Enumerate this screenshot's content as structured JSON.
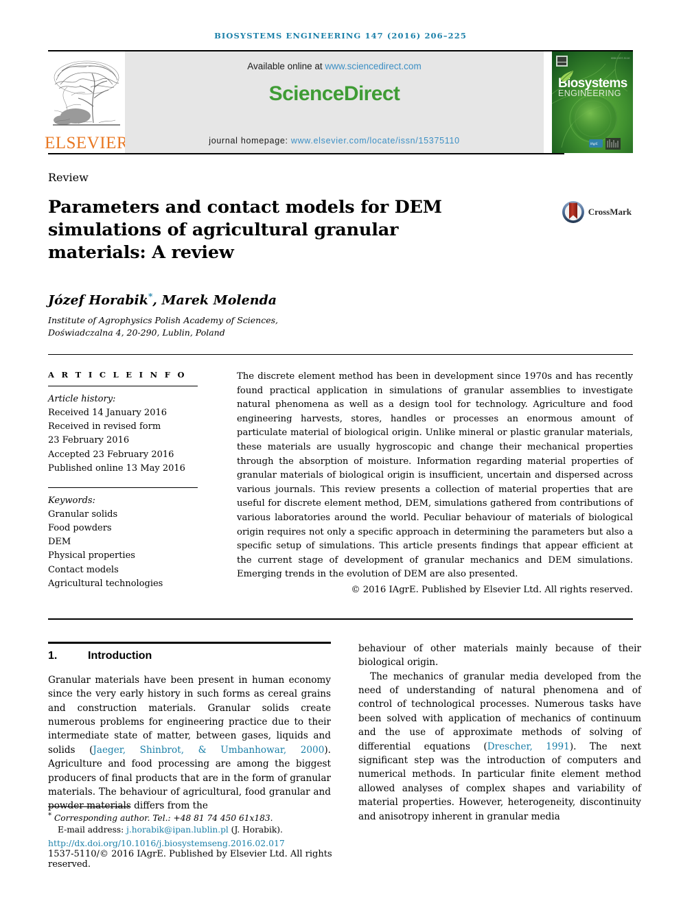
{
  "running_head": "BIOSYSTEMS ENGINEERING 147 (2016) 206–225",
  "masthead": {
    "publisher_name": "ELSEVIER",
    "available_prefix": "Available online at ",
    "available_url": "www.sciencedirect.com",
    "sciencedirect_logo": "ScienceDirect",
    "homepage_label": "journal homepage: ",
    "homepage_url": "www.elsevier.com/locate/issn/15375110",
    "cover_title_line1": "Biosystems",
    "cover_title_line2": "ENGINEERING"
  },
  "article": {
    "kicker": "Review",
    "title": "Parameters and contact models for DEM simulations of agricultural granular materials: A review",
    "crossmark_label": "CrossMark",
    "authors": "Józef Horabik",
    "authors_marker": "*",
    "authors_rest": ", Marek Molenda",
    "affiliation_line1": "Institute of Agrophysics Polish Academy of Sciences,",
    "affiliation_line2": "Doświadczalna 4, 20-290, Lublin, Poland"
  },
  "article_info": {
    "heading": "A R T I C L E   I N F O",
    "history_label": "Article history:",
    "history": [
      "Received 14 January 2016",
      "Received in revised form",
      "23 February 2016",
      "Accepted 23 February 2016",
      "Published online 13 May 2016"
    ],
    "keywords_label": "Keywords:",
    "keywords": [
      "Granular solids",
      "Food powders",
      "DEM",
      "Physical properties",
      "Contact models",
      "Agricultural technologies"
    ]
  },
  "abstract": {
    "text": "The discrete element method has been in development since 1970s and has recently found practical application in simulations of granular assemblies to investigate natural phenomena as well as a design tool for technology. Agriculture and food engineering harvests, stores, handles or processes an enormous amount of particulate material of biological origin. Unlike mineral or plastic granular materials, these materials are usually hygroscopic and change their mechanical properties through the absorption of moisture. Information regarding material properties of granular materials of biological origin is insufficient, uncertain and dispersed across various journals. This review presents a collection of material properties that are useful for discrete element method, DEM, simulations gathered from contributions of various laboratories around the world. Peculiar behaviour of materials of biological origin requires not only a specific approach in determining the parameters but also a specific setup of simulations. This article presents findings that appear efficient at the current stage of development of granular mechanics and DEM simulations. Emerging trends in the evolution of DEM are also presented.",
    "copyright": "© 2016 IAgrE. Published by Elsevier Ltd. All rights reserved."
  },
  "section": {
    "number": "1.",
    "title": "Introduction",
    "left_para_1_a": "Granular materials have been present in human economy since the very early history in such forms as cereal grains and construction materials. Granular solids create numerous problems for engineering practice due to their intermediate state of matter, between gases, liquids and solids (",
    "left_ref_1": "Jaeger, Shinbrot, & Umbanhowar, 2000",
    "left_para_1_b": "). Agriculture and food processing are among the biggest producers of final products that are in the form of granular materials. The behaviour of agricultural, food granular and powder materials differs from the",
    "right_para_1": "behaviour of other materials mainly because of their biological origin.",
    "right_para_2_a": "The mechanics of granular media developed from the need of understanding of natural phenomena and of control of technological processes. Numerous tasks have been solved with application of mechanics of continuum and the use of approximate methods of solving of differential equations (",
    "right_ref_1": "Drescher, 1991",
    "right_para_2_b": "). The next significant step was the introduction of computers and numerical methods. In particular finite element method allowed analyses of complex shapes and variability of material properties. However, heterogeneity, discontinuity and anisotropy inherent in granular media"
  },
  "footer": {
    "corresponding_marker": "*",
    "corresponding_text": " Corresponding author. Tel.: +48 81 74 450 61x183.",
    "email_label": "E-mail address: ",
    "email": "j.horabik@ipan.lublin.pl",
    "email_suffix": " (J. Horabik).",
    "doi": "http://dx.doi.org/10.1016/j.biosystemseng.2016.02.017",
    "issn_line": "1537-5110/© 2016 IAgrE. Published by Elsevier Ltd. All rights reserved."
  },
  "colors": {
    "link_blue": "#1a7fa8",
    "sciencedirect_green": "#3f9c35",
    "elsevier_orange": "#E87722",
    "banner_grey": "#e6e6e6"
  }
}
